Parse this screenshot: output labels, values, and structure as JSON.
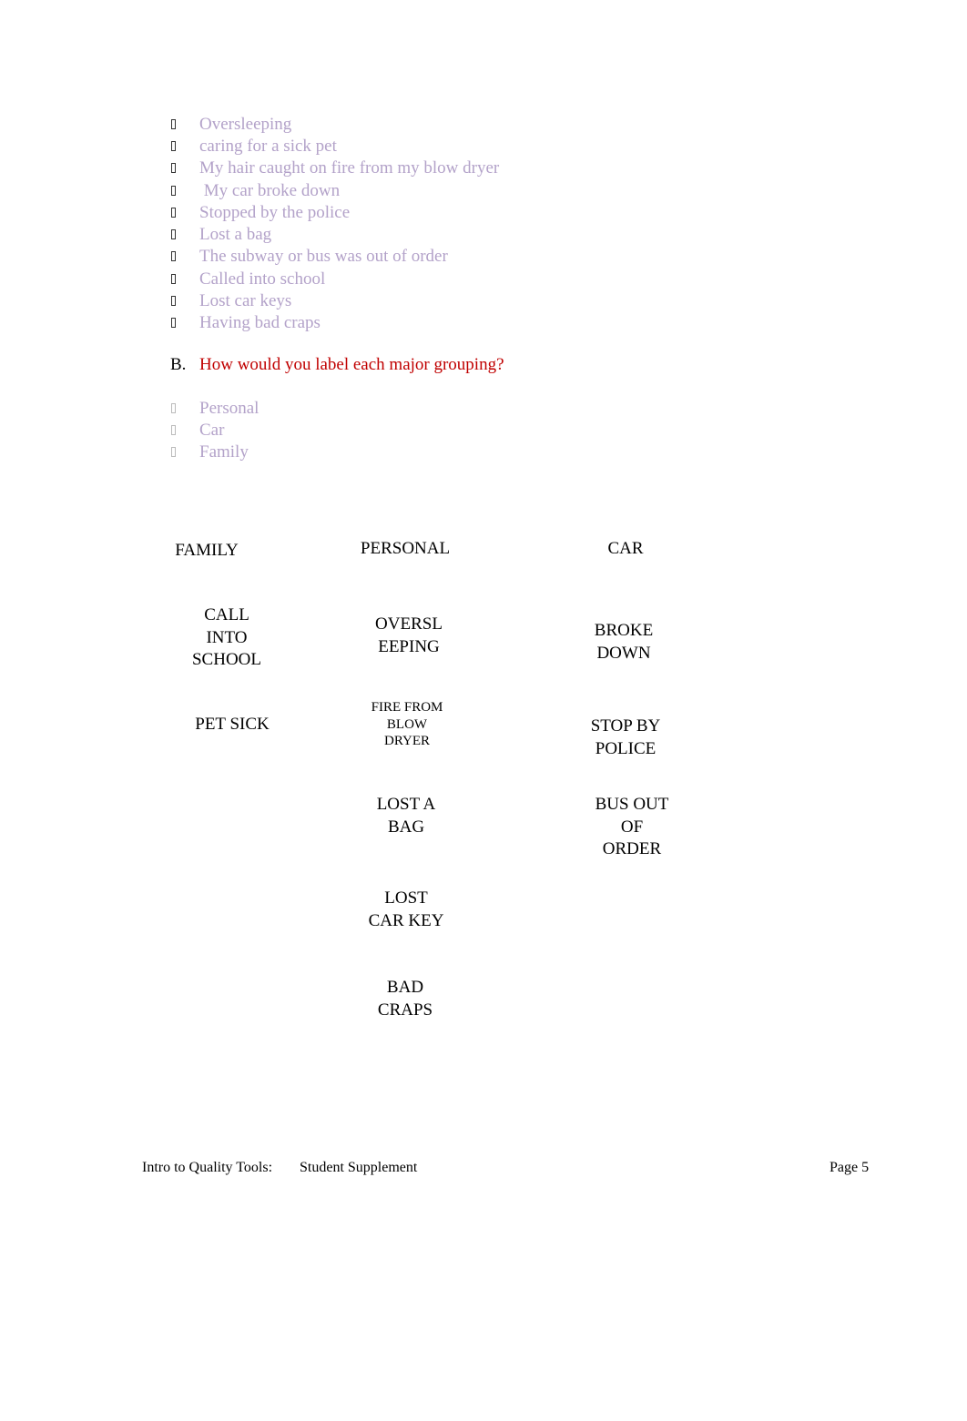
{
  "causes_list": {
    "bullet_icon": "square-bullet-icon",
    "items": [
      "Oversleeping",
      "caring for a sick pet",
      "My hair caught on fire from my blow dryer",
      " My car broke down",
      "Stopped by the police",
      "Lost a bag",
      "The subway or bus was out of order",
      "Called into school",
      "Lost car keys",
      "Having bad craps"
    ]
  },
  "question_b": {
    "letter": "B.",
    "text": "How would you label each major grouping?"
  },
  "grouping_labels": [
    "Personal",
    "Car",
    "Family"
  ],
  "affinity_diagram": {
    "columns": [
      {
        "header": "FAMILY",
        "cards": [
          "CALL\nINTO\nSCHOOL",
          "PET SICK"
        ]
      },
      {
        "header": "PERSONAL",
        "cards": [
          "OVERSL\nEEPING",
          "FIRE FROM\nBLOW\nDRYER",
          "LOST A\nBAG",
          "LOST\nCAR KEY",
          "BAD\nCRAPS"
        ]
      },
      {
        "header": "CAR",
        "cards": [
          "BROKE\nDOWN",
          "STOP BY\nPOLICE",
          "BUS OUT\nOF\nORDER"
        ]
      }
    ]
  },
  "footer": {
    "left": "Intro to Quality Tools:",
    "middle": "Student Supplement",
    "page": "Page 5"
  },
  "colors": {
    "list_text": "#b3a2c9",
    "question_text": "#c00000"
  }
}
